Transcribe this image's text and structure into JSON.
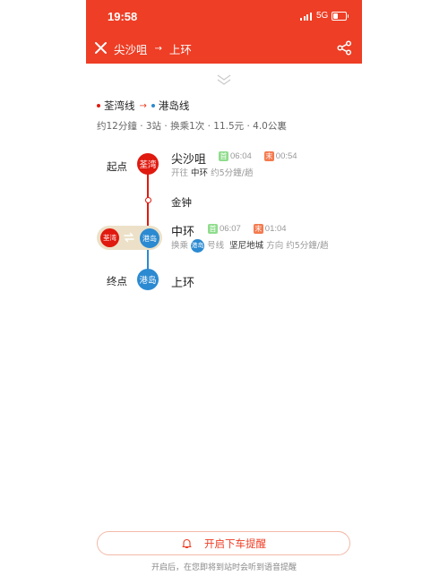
{
  "status_bar": {
    "time": "19:58",
    "network": "5G"
  },
  "header": {
    "from": "尖沙咀",
    "arrow": "→",
    "to": "上环"
  },
  "route": {
    "line1": {
      "name": "荃湾线",
      "color": "#e01a0f"
    },
    "arrow": "→",
    "line2": {
      "name": "港岛线",
      "color": "#2b8ad1"
    },
    "summary": "约12分鐘 · 3站 · 换乘1次 · 11.5元 · 4.0公裏"
  },
  "stations": {
    "start": {
      "side_label": "起点",
      "badge": "荃湾",
      "name": "尖沙咀",
      "first_tag": "首",
      "first_time": "06:04",
      "last_tag": "末",
      "last_time": "00:54",
      "toward_label": "开往",
      "toward": "中环",
      "freq": "约5分鐘/趟"
    },
    "mid": {
      "name": "金钟"
    },
    "transfer": {
      "badge_from": "荃湾",
      "badge_to": "港岛",
      "name": "中环",
      "first_tag": "首",
      "first_time": "06:07",
      "last_tag": "末",
      "last_time": "01:04",
      "transfer_label": "换乘",
      "line_badge": "港岛",
      "line_suffix": "号线",
      "direction_station": "坚尼地城",
      "direction_label": "方向",
      "freq": "约5分鐘/趟"
    },
    "end": {
      "side_label": "终点",
      "badge": "港岛",
      "name": "上环"
    }
  },
  "alarm": {
    "button_label": "开启下车提醒",
    "note": "开启后，在您即将到站时会听到语音提醒"
  },
  "colors": {
    "brand": "#ee3e25",
    "first_tag": "#8fdc8c",
    "last_tag": "#f47a4e"
  }
}
